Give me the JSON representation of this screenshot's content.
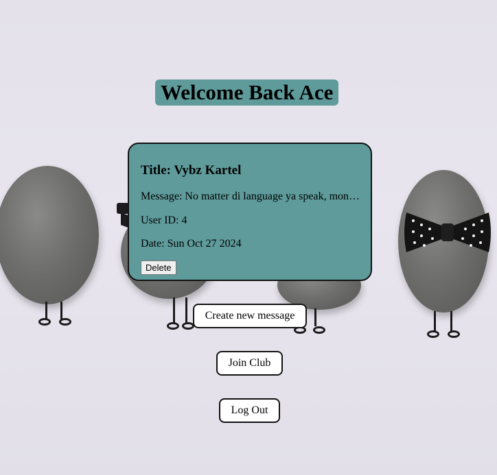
{
  "header": {
    "welcome_text": "Welcome Back Ace"
  },
  "message_card": {
    "title": "Title: Vybz Kartel",
    "message": "Message: No matter di language ya speak, mon…",
    "user_id": "User ID: 4",
    "date": "Date: Sun Oct 27 2024",
    "delete_label": "Delete"
  },
  "actions": {
    "create_label": "Create new message",
    "join_label": "Join Club",
    "logout_label": "Log Out"
  },
  "colors": {
    "accent": "#5f9b9b",
    "background": "#e4e1ea",
    "border": "#111111"
  },
  "icons": [
    "pebble-figure-image",
    "sunglasses-icon",
    "bowtie-icon"
  ]
}
